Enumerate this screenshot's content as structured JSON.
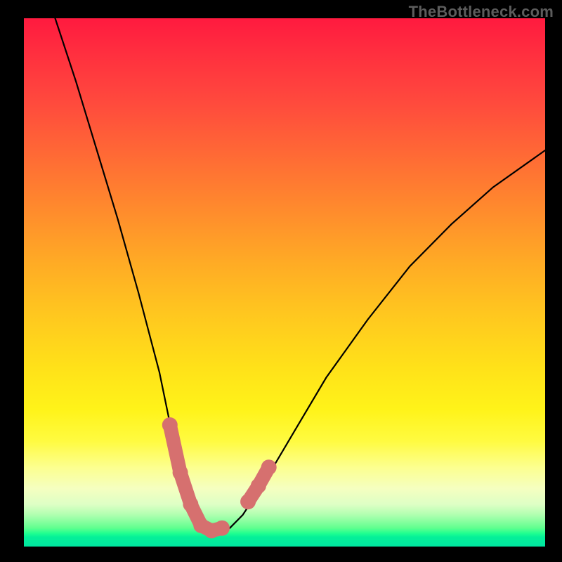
{
  "watermark": "TheBottleneck.com",
  "chart_data": {
    "type": "line",
    "title": "",
    "xlabel": "",
    "ylabel": "",
    "xlim": [
      0,
      1
    ],
    "ylim": [
      0,
      1
    ],
    "grid": false,
    "legend": false,
    "series": [
      {
        "name": "bottleneck-curve",
        "x": [
          0.06,
          0.1,
          0.14,
          0.18,
          0.22,
          0.26,
          0.285,
          0.31,
          0.33,
          0.35,
          0.37,
          0.395,
          0.42,
          0.46,
          0.52,
          0.58,
          0.66,
          0.74,
          0.82,
          0.9,
          1.0
        ],
        "y": [
          1.0,
          0.88,
          0.75,
          0.62,
          0.48,
          0.33,
          0.21,
          0.12,
          0.07,
          0.035,
          0.03,
          0.035,
          0.06,
          0.12,
          0.22,
          0.32,
          0.43,
          0.53,
          0.61,
          0.68,
          0.75
        ]
      }
    ],
    "highlights": [
      {
        "name": "left-dip-highlight",
        "color": "#d6706f",
        "x": [
          0.28,
          0.3,
          0.32,
          0.34,
          0.36,
          0.38
        ],
        "y": [
          0.23,
          0.14,
          0.08,
          0.04,
          0.03,
          0.035
        ]
      },
      {
        "name": "right-dip-highlight",
        "color": "#d6706f",
        "x": [
          0.43,
          0.45,
          0.47
        ],
        "y": [
          0.085,
          0.115,
          0.15
        ]
      }
    ],
    "background": {
      "type": "heat-gradient",
      "stops": [
        {
          "pos": 0.0,
          "color": "#ff1a3f"
        },
        {
          "pos": 0.5,
          "color": "#ffc71f"
        },
        {
          "pos": 0.8,
          "color": "#fffb40"
        },
        {
          "pos": 0.95,
          "color": "#60ff8f"
        },
        {
          "pos": 1.0,
          "color": "#00e6a0"
        }
      ]
    }
  }
}
